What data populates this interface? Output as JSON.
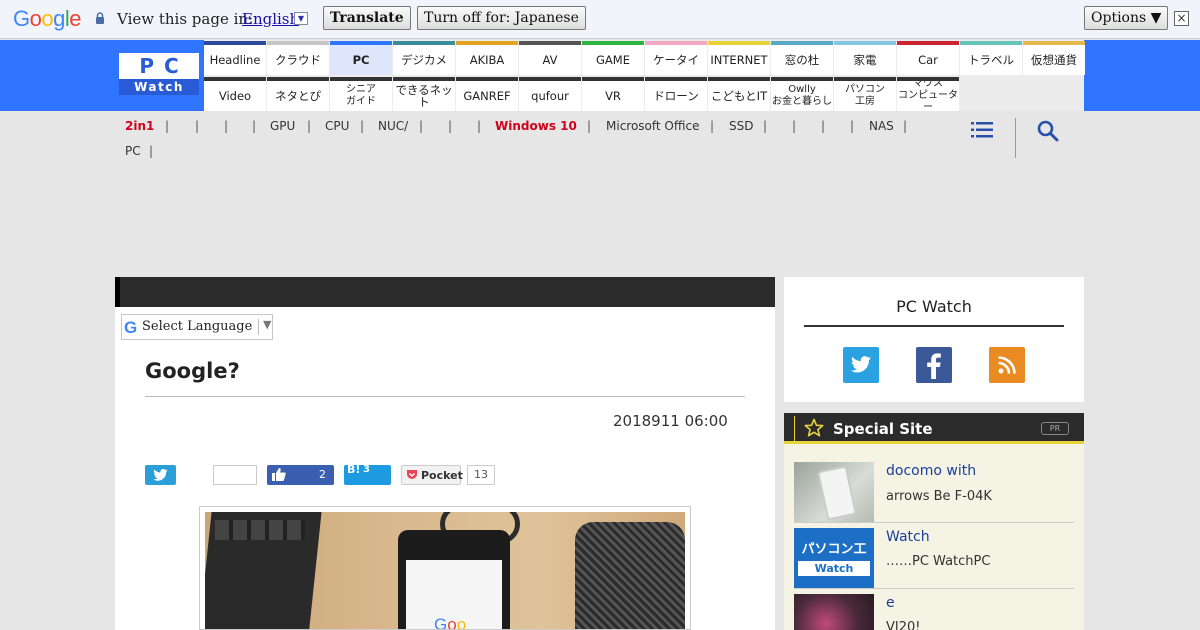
{
  "translate_bar": {
    "logo": "Google",
    "view_label": "View this page in:",
    "language": "English",
    "translate_button": "Translate",
    "turn_off_button": "Turn off for: Japanese",
    "options_button": "Options ▼",
    "close_label": "×"
  },
  "site_logo": {
    "top": "PC",
    "bottom": "Watch"
  },
  "nav": {
    "row1": [
      {
        "label": "Headline",
        "color": "#2b4a9c"
      },
      {
        "label": "クラウド",
        "color": "#c6c6c6"
      },
      {
        "label": "PC",
        "color": "#3075ff"
      },
      {
        "label": "デジカメ",
        "color": "#3a8c9b"
      },
      {
        "label": "AKIBA",
        "color": "#e5a223"
      },
      {
        "label": "AV",
        "color": "#555555"
      },
      {
        "label": "GAME",
        "color": "#2fb344"
      },
      {
        "label": "ケータイ",
        "color": "#f2a7c4"
      },
      {
        "label": "INTERNET",
        "color": "#e8d23a"
      },
      {
        "label": "窓の杜",
        "color": "#5aa7c8"
      },
      {
        "label": "家電",
        "color": "#86c7e3"
      },
      {
        "label": "Car",
        "color": "#c9242f"
      },
      {
        "label": "トラベル",
        "color": "#66c4b8"
      },
      {
        "label": "仮想通貨",
        "color": "#e5b84b"
      }
    ],
    "row2": [
      {
        "label": "Video",
        "color": "#333333"
      },
      {
        "label": "ネタとぴ",
        "color": "#333333"
      },
      {
        "label": "シニア\nガイド",
        "color": "#333333"
      },
      {
        "label": "できるネット",
        "color": "#333333"
      },
      {
        "label": "GANREF",
        "color": "#333333"
      },
      {
        "label": "qufour",
        "color": "#333333"
      },
      {
        "label": "VR",
        "color": "#333333"
      },
      {
        "label": "ドローン",
        "color": "#333333"
      },
      {
        "label": "こどもとIT",
        "color": "#333333"
      },
      {
        "label": "Owlly\nお金と暮らし",
        "color": "#333333"
      },
      {
        "label": "パソコン\n工房",
        "color": "#333333"
      },
      {
        "label": "マウス\nコンピューター",
        "color": "#333333"
      }
    ]
  },
  "subnav": {
    "items": [
      "2in1",
      "GPU",
      "CPU",
      "NUC/",
      "Windows 10",
      "Microsoft Office",
      "SSD",
      "NAS",
      "PC"
    ],
    "highlight_color": "#d0021b"
  },
  "language_select": {
    "label": "Select Language"
  },
  "article": {
    "title": "Google?",
    "date": "2018911 06:00"
  },
  "share": {
    "facebook_count": "2",
    "hatena_label": "B!",
    "hatena_count": "3",
    "pocket_label": "Pocket",
    "pocket_count": "13"
  },
  "social_box": {
    "title": "PC Watch",
    "icons": [
      "twitter-icon",
      "facebook-icon",
      "rss-icon"
    ]
  },
  "special_site": {
    "title": "Special Site",
    "badge": "PR",
    "items": [
      {
        "title": "docomo with",
        "subtitle": "arrows Be F-04K"
      },
      {
        "title": " Watch",
        "subtitle": "……PC WatchPC"
      },
      {
        "title": "e",
        "subtitle": "VI20!"
      }
    ]
  },
  "colors": {
    "header_blue": "#3075ff",
    "dark_bar": "#2b2b2b",
    "accent_yellow": "#e8d23a"
  }
}
